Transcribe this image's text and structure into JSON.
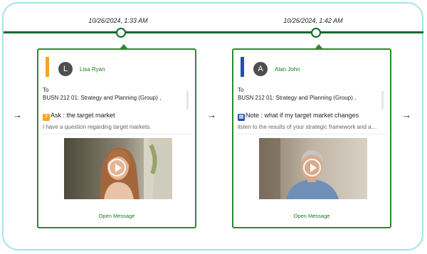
{
  "timeline": {
    "items": [
      {
        "timestamp": "10/26/2024, 1:33 AM",
        "author_initial": "L",
        "author_name": "Lisa Ryan",
        "accent_color": "#f5a623",
        "to_label": "To",
        "course": "BUSN 212 01: Strategy and Planning (Group) ,",
        "subject_icon": "question-icon",
        "subject": "Ask : the target market",
        "preview": "I have a question regarding target markets.",
        "video_thumbnail": "woman-video-thumbnail",
        "open_label": "Open Message"
      },
      {
        "timestamp": "10/26/2024, 1:42 AM",
        "author_initial": "A",
        "author_name": "Alan John",
        "accent_color": "#1f4fb4",
        "to_label": "To",
        "course": "BUSN 212 01: Strategy and Planning (Group) ,",
        "subject_icon": "note-icon",
        "subject": "Note : what if my target market changes",
        "preview": "listen to the results of your strategic framework and ada...",
        "video_thumbnail": "man-video-thumbnail",
        "open_label": "Open Message"
      }
    ],
    "arrow": "→"
  },
  "colors": {
    "timeline": "#0f6a2b",
    "card_border": "#2a8a2e",
    "link": "#1a7a1e",
    "frame": "#a5e3e9"
  }
}
